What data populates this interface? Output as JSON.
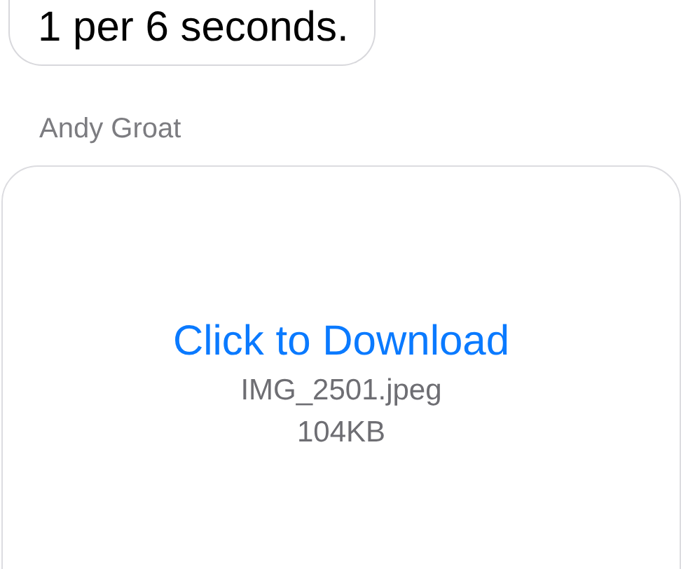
{
  "messages": [
    {
      "kind": "text",
      "text": "1 per 6 seconds."
    },
    {
      "kind": "attachment",
      "sender": "Andy Groat",
      "link": "Click to Download",
      "filename": "IMG_2501.jpeg",
      "size": "104KB"
    }
  ]
}
